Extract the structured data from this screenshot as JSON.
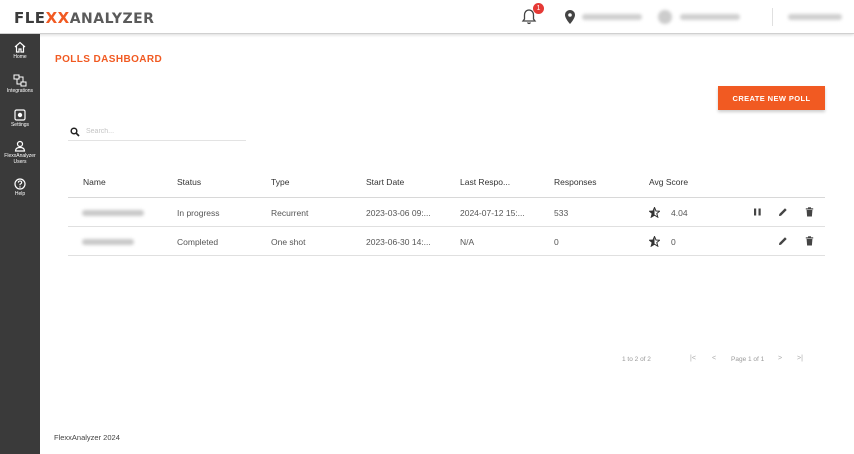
{
  "brand": {
    "part1": "FLE",
    "part2": "XX",
    "part3": "ANALYZER"
  },
  "header": {
    "notification_count": "1"
  },
  "sidebar": {
    "items": [
      {
        "label": "Home"
      },
      {
        "label": "Integrations"
      },
      {
        "label": "Settings"
      },
      {
        "label": "FlexxAnalyzer Users"
      },
      {
        "label": "Help"
      }
    ]
  },
  "page": {
    "title": "POLLS DASHBOARD",
    "create_label": "CREATE NEW POLL"
  },
  "search": {
    "placeholder": "Search..."
  },
  "table": {
    "headers": [
      "Name",
      "Status",
      "Type",
      "Start Date",
      "Last Respo...",
      "Responses",
      "Avg Score"
    ],
    "rows": [
      {
        "status": "In progress",
        "type": "Recurrent",
        "start": "2023-03-06 09:...",
        "last": "2024-07-12 15:...",
        "responses": "533",
        "score": "4.04"
      },
      {
        "status": "Completed",
        "type": "One shot",
        "start": "2023-06-30 14:...",
        "last": "N/A",
        "responses": "0",
        "score": "0"
      }
    ]
  },
  "pagination": {
    "range": "1 to 2 of 2",
    "page": "Page 1 of 1"
  },
  "footer": {
    "text": "FlexxAnalyzer 2024"
  },
  "colors": {
    "accent": "#f15a22",
    "sidebar": "#3a3a3a"
  }
}
